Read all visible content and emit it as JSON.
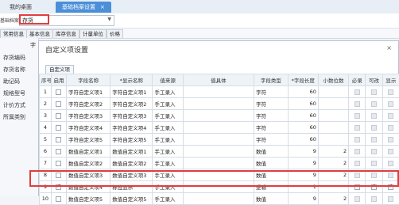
{
  "tabs": [
    "我的桌面",
    "基础档案设置"
  ],
  "header": {
    "basic_label": "基础档案",
    "archive_value": "存货"
  },
  "subtabs": [
    "常用信息",
    "基本信息",
    "库存信息",
    "计量单位",
    "价格"
  ],
  "sidebar": {
    "top_label": "字",
    "items": [
      "存货编码",
      "存货名称",
      "助记码",
      "规格型号",
      "计价方式",
      "所属类别"
    ]
  },
  "dialog": {
    "title": "自定义项设置",
    "close": "×",
    "tab": "自定义项"
  },
  "columns": [
    "序号",
    "启用",
    "字段名称",
    "*显示名称",
    "值来源",
    "值具体",
    "字段类型",
    "*字段长度",
    "小数位数",
    "必录",
    "可改",
    "显示"
  ],
  "rows": [
    {
      "n": "1",
      "en": false,
      "field": "字符自定义项1",
      "disp": "字符自定义项1",
      "src": "手工录入",
      "val": "",
      "type": "字符",
      "len": "60",
      "dec": "",
      "req": false,
      "mod": false,
      "show": false
    },
    {
      "n": "2",
      "en": false,
      "field": "字符自定义项2",
      "disp": "字符自定义项2",
      "src": "手工录入",
      "val": "",
      "type": "字符",
      "len": "60",
      "dec": "",
      "req": false,
      "mod": false,
      "show": false
    },
    {
      "n": "3",
      "en": false,
      "field": "字符自定义项3",
      "disp": "字符自定义项3",
      "src": "手工录入",
      "val": "",
      "type": "字符",
      "len": "60",
      "dec": "",
      "req": false,
      "mod": false,
      "show": false
    },
    {
      "n": "4",
      "en": false,
      "field": "字符自定义项4",
      "disp": "字符自定义项4",
      "src": "手工录入",
      "val": "",
      "type": "字符",
      "len": "60",
      "dec": "",
      "req": false,
      "mod": false,
      "show": false
    },
    {
      "n": "5",
      "en": false,
      "field": "字符自定义项5",
      "disp": "字符自定义项5",
      "src": "手工录入",
      "val": "",
      "type": "字符",
      "len": "60",
      "dec": "",
      "req": false,
      "mod": false,
      "show": false
    },
    {
      "n": "6",
      "en": false,
      "field": "数值自定义项1",
      "disp": "数值自定义项1",
      "src": "手工录入",
      "val": "",
      "type": "数值",
      "len": "9",
      "dec": "2",
      "req": false,
      "mod": false,
      "show": false
    },
    {
      "n": "7",
      "en": false,
      "field": "数值自定义项2",
      "disp": "数值自定义项2",
      "src": "手工录入",
      "val": "",
      "type": "数值",
      "len": "9",
      "dec": "2",
      "req": false,
      "mod": false,
      "show": false
    },
    {
      "n": "8",
      "en": false,
      "field": "数值自定义项3",
      "disp": "数值自定义项3",
      "src": "手工录入",
      "val": "",
      "type": "数值",
      "len": "9",
      "dec": "2",
      "req": false,
      "mod": false,
      "show": false
    },
    {
      "n": "9",
      "en": true,
      "field": "数值自定义项4",
      "disp": "标签显示",
      "src": "手工录入",
      "val": "",
      "type": "逻辑",
      "len": "1",
      "dec": "",
      "req": false,
      "mod": true,
      "show": true
    },
    {
      "n": "10",
      "en": false,
      "field": "数值自定义项5",
      "disp": "数值自定义项5",
      "src": "手工录入",
      "val": "",
      "type": "数值",
      "len": "9",
      "dec": "2",
      "req": false,
      "mod": false,
      "show": false
    }
  ]
}
